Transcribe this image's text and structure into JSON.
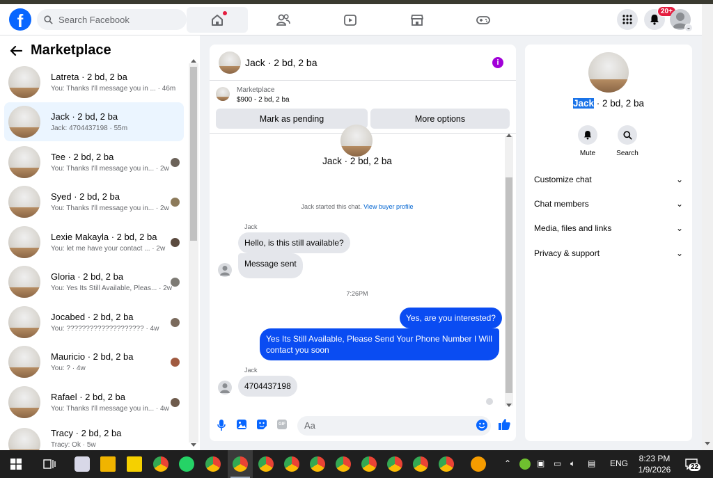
{
  "topbar": {
    "logo": "f",
    "search_placeholder": "Search Facebook",
    "notifications_badge": "20+",
    "nav_icons": [
      "home-icon",
      "friends-icon",
      "watch-icon",
      "marketplace-icon",
      "gaming-icon"
    ]
  },
  "sidebar": {
    "title": "Marketplace",
    "conversations": [
      {
        "name": "Latreta · 2 bd, 2 ba",
        "preview": "You: Thanks I'll message you in ... · 46m"
      },
      {
        "name": "Jack · 2 bd, 2 ba",
        "preview": "Jack: 4704437198 · 55m"
      },
      {
        "name": "Tee · 2 bd, 2 ba",
        "preview": "You: Thanks I'll message you in... · 2w"
      },
      {
        "name": "Syed · 2 bd, 2 ba",
        "preview": "You: Thanks I'll message you in... · 2w"
      },
      {
        "name": "Lexie Makayla · 2 bd, 2 ba",
        "preview": "You: let me have your contact ... · 2w"
      },
      {
        "name": "Gloria · 2 bd, 2 ba",
        "preview": "You: Yes Its Still Available, Pleas... · 2w"
      },
      {
        "name": "Jocabed · 2 bd, 2 ba",
        "preview": "You: ???????????????????? · 4w"
      },
      {
        "name": "Mauricio · 2 bd, 2 ba",
        "preview": "You: ? · 4w"
      },
      {
        "name": "Rafael · 2 bd, 2 ba",
        "preview": "You: Thanks I'll message you in... · 4w"
      },
      {
        "name": "Tracy · 2 bd, 2 ba",
        "preview": "Tracy: Ok · 5w"
      }
    ]
  },
  "chat": {
    "title": "Jack · 2 bd, 2 ba",
    "marketplace_label": "Marketplace",
    "listing_price": "$900 - 2 bd, 2 ba",
    "mark_pending": "Mark as pending",
    "more_options": "More options",
    "header_name": "Jack · 2 bd, 2 ba",
    "started_text": "Jack started this chat.",
    "view_profile": "View buyer profile",
    "sender1": "Jack",
    "msg1": "Hello, is this still available?",
    "msg2": "Message sent",
    "time": "7:26PM",
    "out1": "Yes, are you interested?",
    "out2": "Yes Its Still Available, Please Send Your Phone Number I Will contact you soon",
    "sender2": "Jack",
    "msg3": "4704437198",
    "composer_placeholder": "Aa"
  },
  "details": {
    "name_first": "Jack",
    "name_rest": " · 2 bd, 2 ba",
    "mute": "Mute",
    "search": "Search",
    "rows": [
      "Customize chat",
      "Chat members",
      "Media, files and links",
      "Privacy & support"
    ]
  },
  "taskbar": {
    "lang": "ENG",
    "time": "8:23 PM",
    "date": "1/9/2026",
    "notif_count": "22"
  },
  "colors": {
    "brand": "#0866ff",
    "outgoing": "#0a4cf2",
    "info": "#a100d8",
    "selected": "#ebf5ff"
  }
}
